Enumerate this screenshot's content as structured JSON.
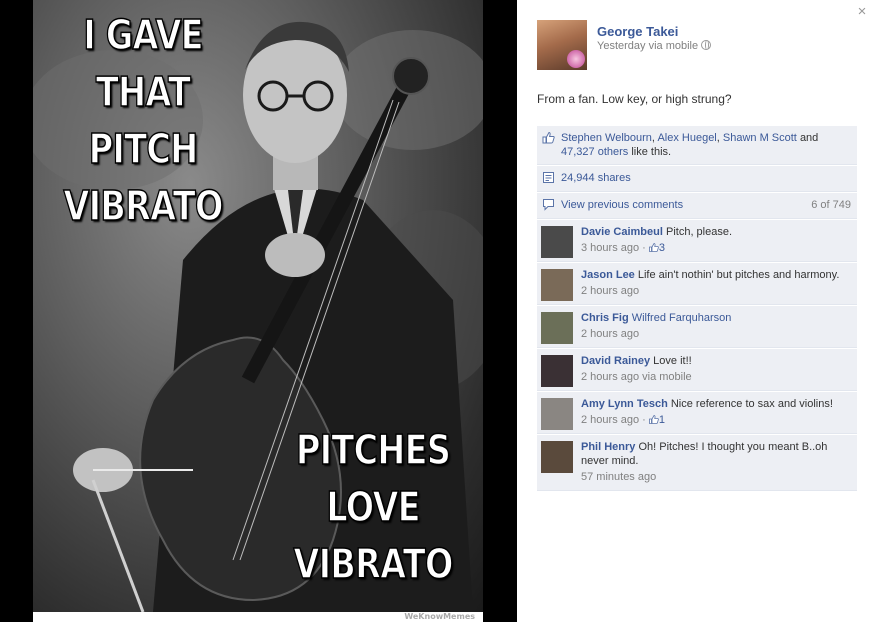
{
  "photo": {
    "meme_top_lines": [
      "I GAVE",
      "THAT",
      "PITCH",
      "VIBRATO"
    ],
    "meme_bottom_lines": [
      "PITCHES",
      "LOVE",
      "VIBRATO"
    ],
    "watermark": "WeKnowMemes"
  },
  "panel": {
    "close_label": "×",
    "author": {
      "name": "George Takei",
      "meta": "Yesterday via mobile"
    },
    "caption": "From a fan. Low key, or high strung?",
    "likes": {
      "names": [
        "Stephen Welbourn",
        "Alex Huegel",
        "Shawn M Scott"
      ],
      "and_text": "and",
      "others_count": "47,327",
      "others_word": "others",
      "suffix": "like this."
    },
    "shares": "24,944 shares",
    "previous_comments": {
      "label": "View previous comments",
      "count": "6 of 749"
    },
    "comments": [
      {
        "name": "Davie Caimbeul",
        "text": "Pitch, please.",
        "time": "3 hours ago",
        "likes": "3",
        "avatar_color": "#4a4a4a"
      },
      {
        "name": "Jason Lee",
        "text": "Life ain't nothin' but pitches and harmony.",
        "time": "2 hours ago",
        "likes": "",
        "avatar_color": "#7a6a58"
      },
      {
        "name": "Chris Fig",
        "text": "Wilfred Farquharson",
        "time": "2 hours ago",
        "likes": "",
        "avatar_color": "#6b6f58"
      },
      {
        "name": "David Rainey",
        "text": "Love it!!",
        "time": "2 hours ago via mobile",
        "likes": "",
        "avatar_color": "#3a3034"
      },
      {
        "name": "Amy Lynn Tesch",
        "text": "Nice reference to sax and violins!",
        "time": "2 hours ago",
        "likes": "1",
        "avatar_color": "#8a8682"
      },
      {
        "name": "Phil Henry",
        "text": "Oh! Pitches! I thought you meant B..oh never mind.",
        "time": "57 minutes ago",
        "likes": "",
        "avatar_color": "#5a4a3c"
      }
    ]
  },
  "colors": {
    "link": "#3b5998",
    "ufi_background": "#edeff4",
    "muted": "#808080"
  }
}
